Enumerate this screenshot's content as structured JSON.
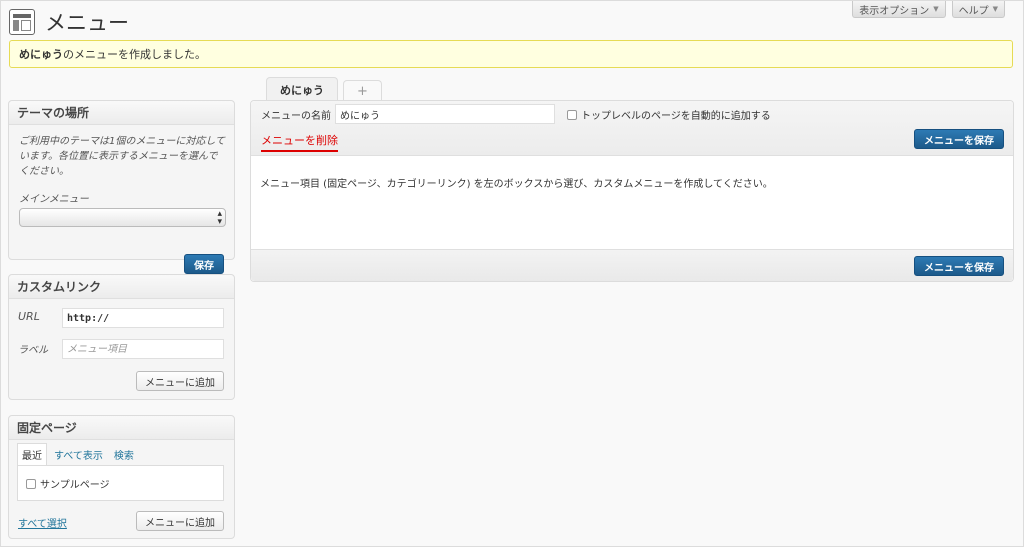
{
  "header": {
    "title": "メニュー",
    "screen_options_label": "表示オプション",
    "help_label": "ヘルプ"
  },
  "notice": {
    "menu_name": "めにゅう",
    "message": "のメニューを作成しました。"
  },
  "theme_locations": {
    "title": "テーマの場所",
    "description": "ご利用中のテーマは1個のメニューに対応しています。各位置に表示するメニューを選んでください。",
    "main_menu_label": "メインメニュー",
    "main_menu_value": "",
    "save_label": "保存"
  },
  "custom_links": {
    "title": "カスタムリンク",
    "url_label": "URL",
    "url_value": "http://",
    "label_label": "ラベル",
    "label_placeholder": "メニュー項目",
    "add_label": "メニューに追加"
  },
  "pages": {
    "title": "固定ページ",
    "tabs": [
      "最近",
      "すべて表示",
      "検索"
    ],
    "items": [
      "サンプルページ"
    ],
    "select_all_label": "すべて選択",
    "add_label": "メニューに追加"
  },
  "menu_tabs": {
    "active": "めにゅう",
    "add": "+"
  },
  "editor": {
    "name_label": "メニューの名前",
    "name_value": "めにゅう",
    "auto_add_label": "トップレベルのページを自動的に追加する",
    "delete_label": "メニューを削除",
    "save_label": "メニューを保存",
    "instructions": "メニュー項目 (固定ページ、カテゴリーリンク) を左のボックスから選び、カスタムメニューを作成してください。"
  }
}
